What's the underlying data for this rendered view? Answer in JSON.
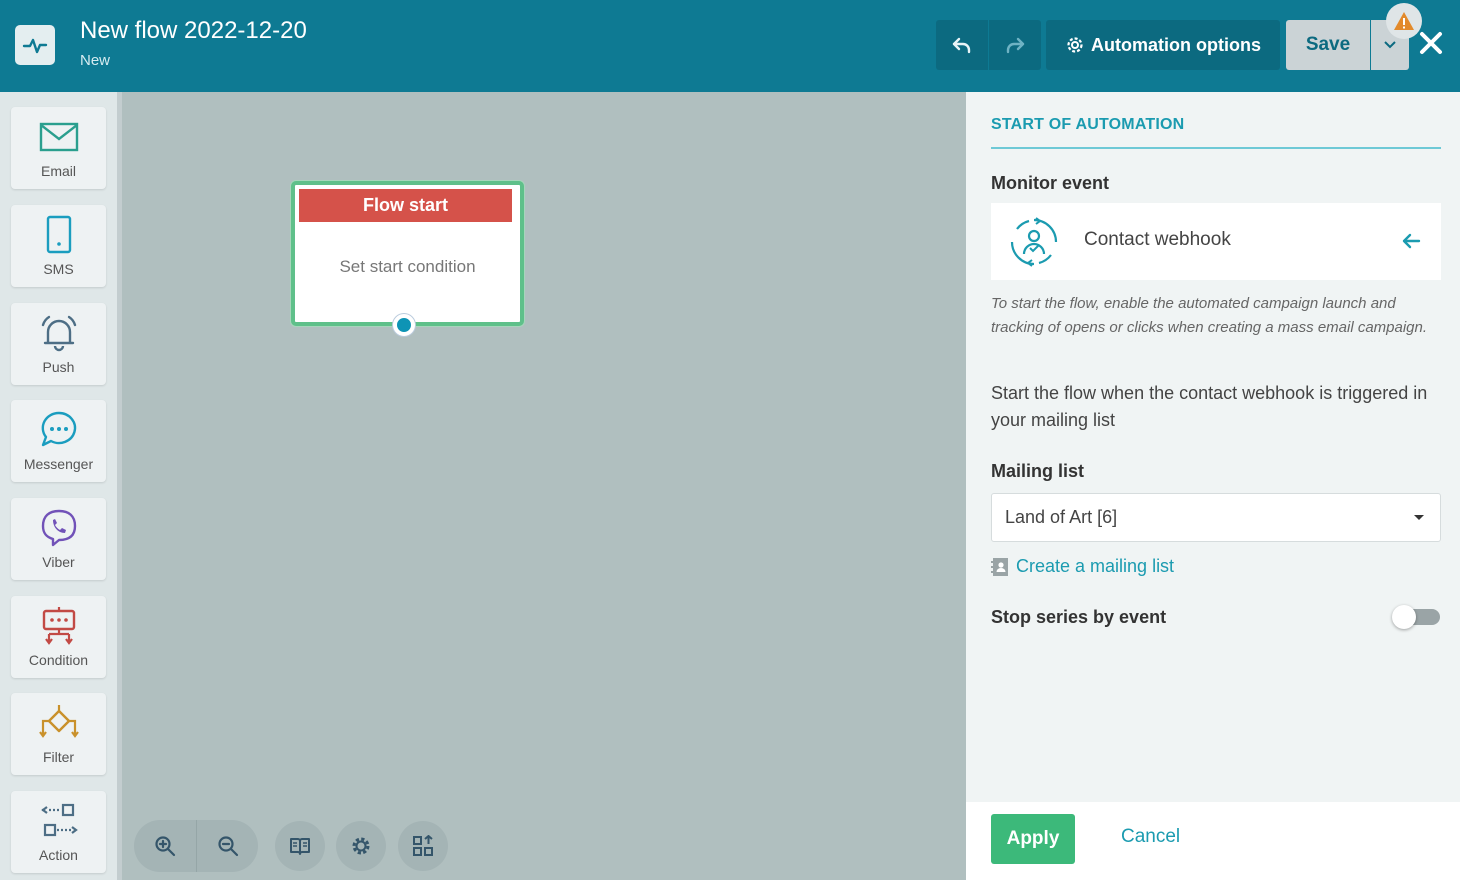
{
  "header": {
    "title": "New flow 2022-12-20",
    "status": "New",
    "automation_options_label": "Automation options",
    "save_label": "Save"
  },
  "sidebar": {
    "items": [
      {
        "label": "Email",
        "icon": "envelope-icon"
      },
      {
        "label": "SMS",
        "icon": "phone-icon"
      },
      {
        "label": "Push",
        "icon": "bell-icon"
      },
      {
        "label": "Messenger",
        "icon": "chat-bubble-icon"
      },
      {
        "label": "Viber",
        "icon": "viber-icon"
      },
      {
        "label": "Condition",
        "icon": "condition-icon"
      },
      {
        "label": "Filter",
        "icon": "filter-icon"
      },
      {
        "label": "Action",
        "icon": "action-icon"
      }
    ]
  },
  "canvas": {
    "node": {
      "title": "Flow start",
      "body": "Set start condition"
    }
  },
  "panel": {
    "title": "START OF AUTOMATION",
    "monitor_event_label": "Monitor event",
    "event_name": "Contact webhook",
    "hint": "To start the flow, enable the automated campaign launch and tracking of opens or clicks when creating a mass email campaign.",
    "description": "Start the flow when the contact webhook is triggered in your mailing list",
    "mailing_list_label": "Mailing list",
    "mailing_list_value": "Land of Art [6]",
    "create_link": "Create a mailing list",
    "stop_series_label": "Stop series by event",
    "stop_series_enabled": false
  },
  "footer": {
    "apply_label": "Apply",
    "cancel_label": "Cancel"
  },
  "colors": {
    "header": "#0e7a93",
    "accent": "#1b9bb0",
    "node_header": "#d5524a",
    "node_border": "#5fc08a",
    "apply": "#3cb97a"
  }
}
